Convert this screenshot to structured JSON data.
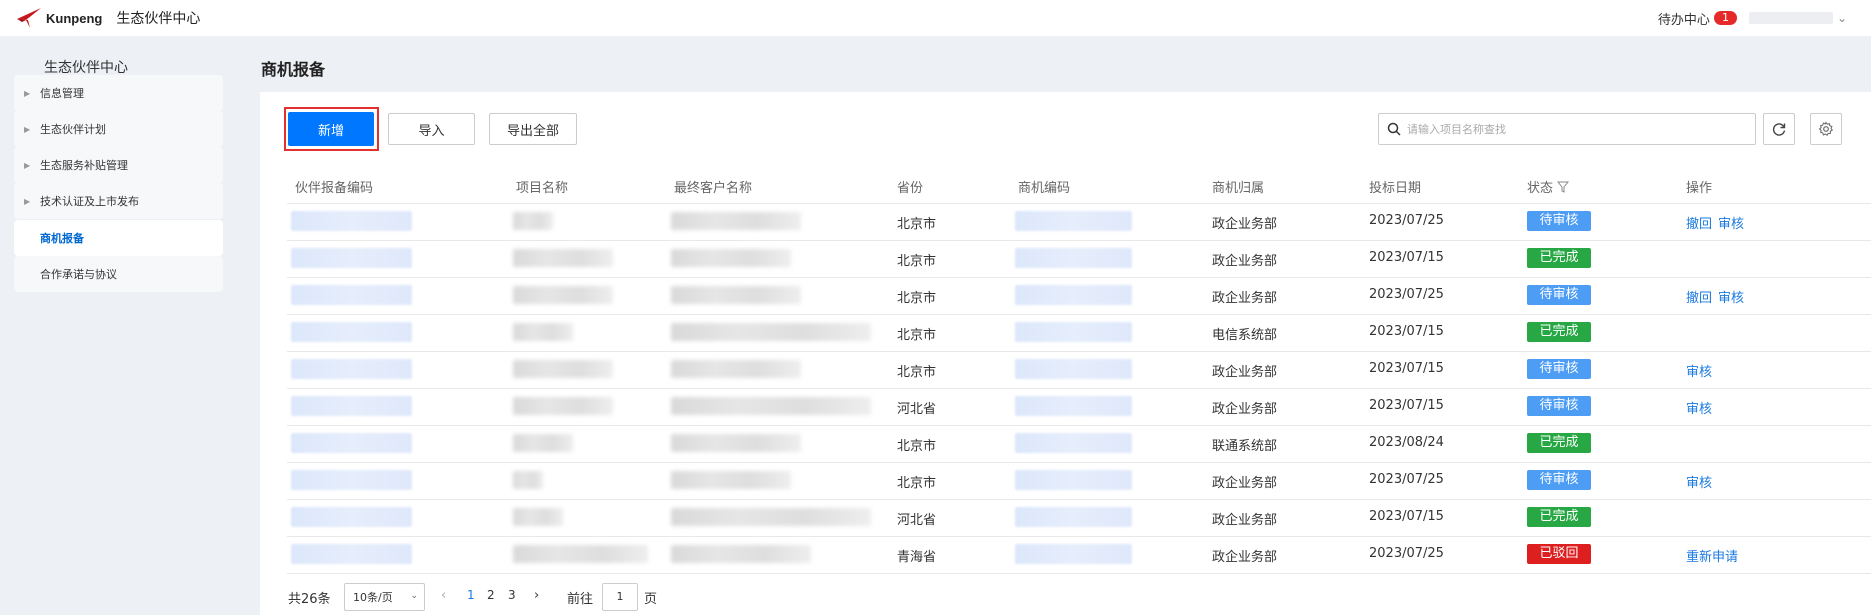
{
  "header": {
    "logo_text": "Kunpeng",
    "app_title": "生态伙伴中心",
    "todo_label": "待办中心",
    "todo_count": "1"
  },
  "sidebar": {
    "title": "生态伙伴中心",
    "items": [
      {
        "label": "信息管理",
        "has_arrow": true,
        "active": false
      },
      {
        "label": "生态伙伴计划",
        "has_arrow": true,
        "active": false
      },
      {
        "label": "生态服务补贴管理",
        "has_arrow": true,
        "active": false
      },
      {
        "label": "技术认证及上市发布",
        "has_arrow": true,
        "active": false
      },
      {
        "label": "商机报备",
        "has_arrow": false,
        "active": true
      },
      {
        "label": "合作承诺与协议",
        "has_arrow": false,
        "active": false
      }
    ]
  },
  "main": {
    "page_title": "商机报备",
    "buttons": {
      "add": "新增",
      "import": "导入",
      "export": "导出全部"
    },
    "search": {
      "placeholder": "请输入项目名称查找"
    },
    "table": {
      "columns": [
        "伙伴报备编码",
        "项目名称",
        "最终客户名称",
        "省份",
        "商机编码",
        "商机归属",
        "投标日期",
        "状态",
        "操作"
      ],
      "rows": [
        {
          "province": "北京市",
          "dept": "政企业务部",
          "date": "2023/07/25",
          "status": "待审核",
          "status_type": "pending",
          "actions": [
            "撤回",
            "审核"
          ]
        },
        {
          "province": "北京市",
          "dept": "政企业务部",
          "date": "2023/07/15",
          "status": "已完成",
          "status_type": "done",
          "actions": []
        },
        {
          "province": "北京市",
          "dept": "政企业务部",
          "date": "2023/07/25",
          "status": "待审核",
          "status_type": "pending",
          "actions": [
            "撤回",
            "审核"
          ]
        },
        {
          "province": "北京市",
          "dept": "电信系统部",
          "date": "2023/07/15",
          "status": "已完成",
          "status_type": "done",
          "actions": []
        },
        {
          "province": "北京市",
          "dept": "政企业务部",
          "date": "2023/07/15",
          "status": "待审核",
          "status_type": "pending",
          "actions": [
            "审核"
          ]
        },
        {
          "province": "河北省",
          "dept": "政企业务部",
          "date": "2023/07/15",
          "status": "待审核",
          "status_type": "pending",
          "actions": [
            "审核"
          ]
        },
        {
          "province": "北京市",
          "dept": "联通系统部",
          "date": "2023/08/24",
          "status": "已完成",
          "status_type": "done",
          "actions": []
        },
        {
          "province": "北京市",
          "dept": "政企业务部",
          "date": "2023/07/25",
          "status": "待审核",
          "status_type": "pending",
          "actions": [
            "审核"
          ]
        },
        {
          "province": "河北省",
          "dept": "政企业务部",
          "date": "2023/07/15",
          "status": "已完成",
          "status_type": "done",
          "actions": []
        },
        {
          "province": "青海省",
          "dept": "政企业务部",
          "date": "2023/07/25",
          "status": "已驳回",
          "status_type": "rejected",
          "actions": [
            "重新申请"
          ]
        }
      ]
    },
    "pagination": {
      "total": "共26条",
      "page_size": "10条/页",
      "pages": [
        "1",
        "2",
        "3"
      ],
      "current_page": "1",
      "goto_label": "前往",
      "goto_value": "1",
      "page_unit": "页"
    }
  },
  "colors": {
    "primary": "#0077ff",
    "pending": "#4e9df5",
    "done": "#27a844",
    "rejected": "#dd1f1f",
    "link": "#1a7ae0",
    "highlight_border": "#e53030"
  }
}
